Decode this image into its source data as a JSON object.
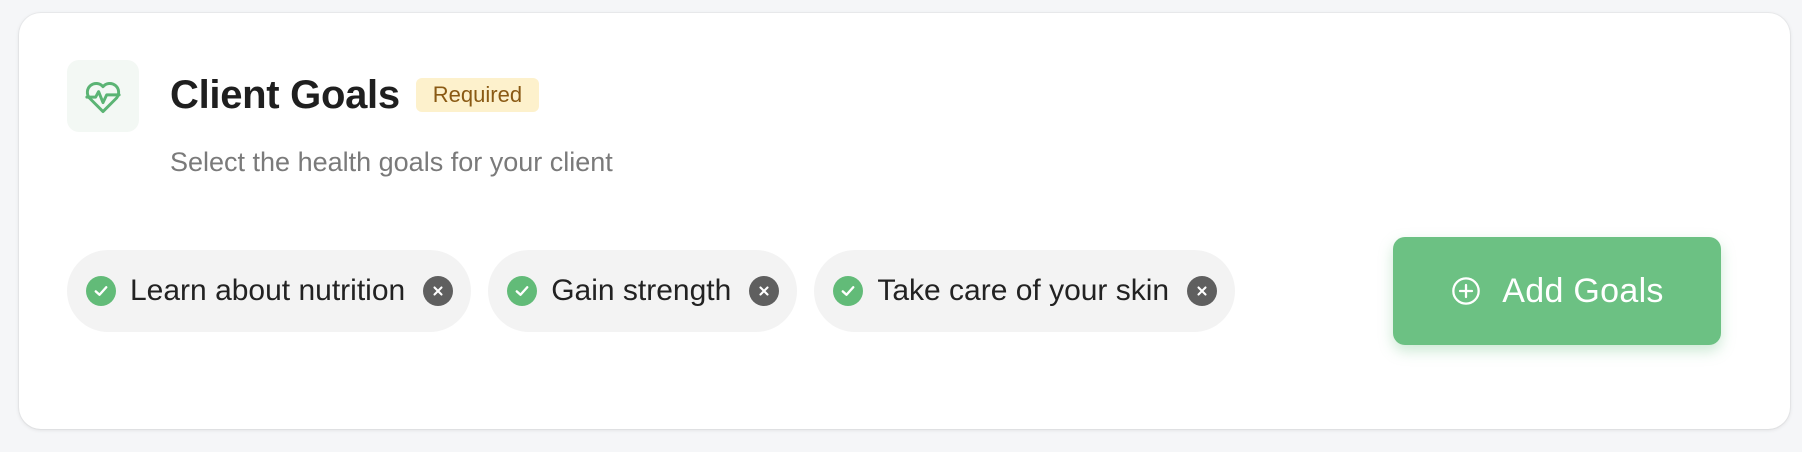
{
  "header": {
    "icon": "heart-pulse-icon",
    "title": "Client Goals",
    "badge": "Required",
    "subtitle": "Select the health goals for your client"
  },
  "goals": [
    {
      "label": "Learn about nutrition",
      "checked": true
    },
    {
      "label": "Gain strength",
      "checked": true
    },
    {
      "label": "Take care of your skin",
      "checked": true
    }
  ],
  "actions": {
    "add_label": "Add Goals",
    "add_icon": "plus-circle-icon"
  },
  "colors": {
    "accent": "#6cc183",
    "check": "#62bb78",
    "remove": "#5f5f5f",
    "badge_bg": "#fdf1cc",
    "badge_text": "#8a5a14"
  }
}
